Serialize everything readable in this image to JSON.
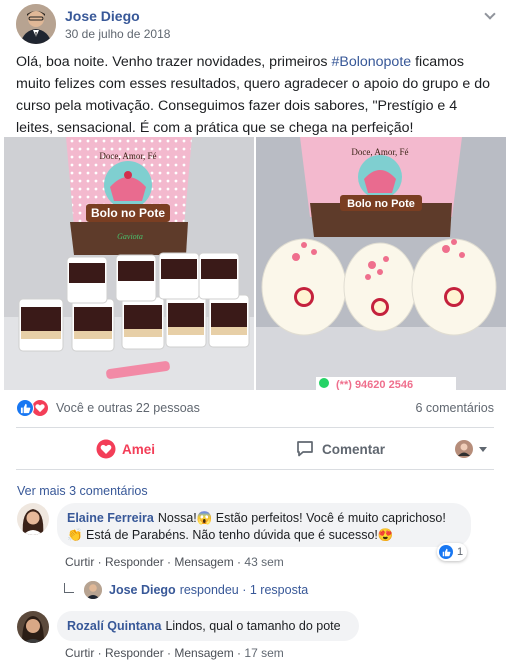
{
  "post": {
    "author": "Jose Diego",
    "date": "30 de julho de 2018",
    "text_before": "Olá, boa noite. Venho trazer novidades, primeiros ",
    "hashtag": "#Bolonopote",
    "text_after": " ficamos muito felizes com esses resultados, quero agradecer o apoio do grupo e do curso pela motivação. Conseguimos fazer dois sabores, \"Prestígio e 4 leites, sensacional. É com a prática que se chega na perfeição!",
    "image_left": {
      "sign_line1": "Doce, Amor, Fé",
      "sign_brand": "Bolo no Pote",
      "sign_small": "Gaviota"
    },
    "image_right": {
      "sign_line1": "Doce, Amor, Fé",
      "sign_brand": "Bolo no Pote",
      "phone": "(**) 94620 2546"
    }
  },
  "reactions": {
    "summary": "Você e outras 22 pessoas",
    "comments_count": "6 comentários",
    "colors": {
      "like": "#1877f2",
      "love": "#f33e58"
    }
  },
  "actions": {
    "love_label": "Amei",
    "comment_label": "Comentar"
  },
  "comments_section": {
    "view_more": "Ver mais 3 comentários",
    "comments": [
      {
        "name": "Elaine Ferreira",
        "line1": "Nossa!😱 Estão perfeitos! Você é muito caprichoso!",
        "line2": "👏 Está de Parabéns. Não tenho dúvida que é sucesso!😍",
        "reply_label": "Curtir · Responder · Mensagem · ",
        "time": "43 sem",
        "like_badge_count": "1"
      },
      {
        "name": "Rozalí Quintana",
        "line1": "Lindos, qual o tamanho do pote",
        "reply_label": "Curtir · Responder · Mensagem · ",
        "time": "17 sem"
      }
    ],
    "reply_summary": {
      "author": "Jose Diego",
      "text": "respondeu · 1 resposta"
    }
  }
}
